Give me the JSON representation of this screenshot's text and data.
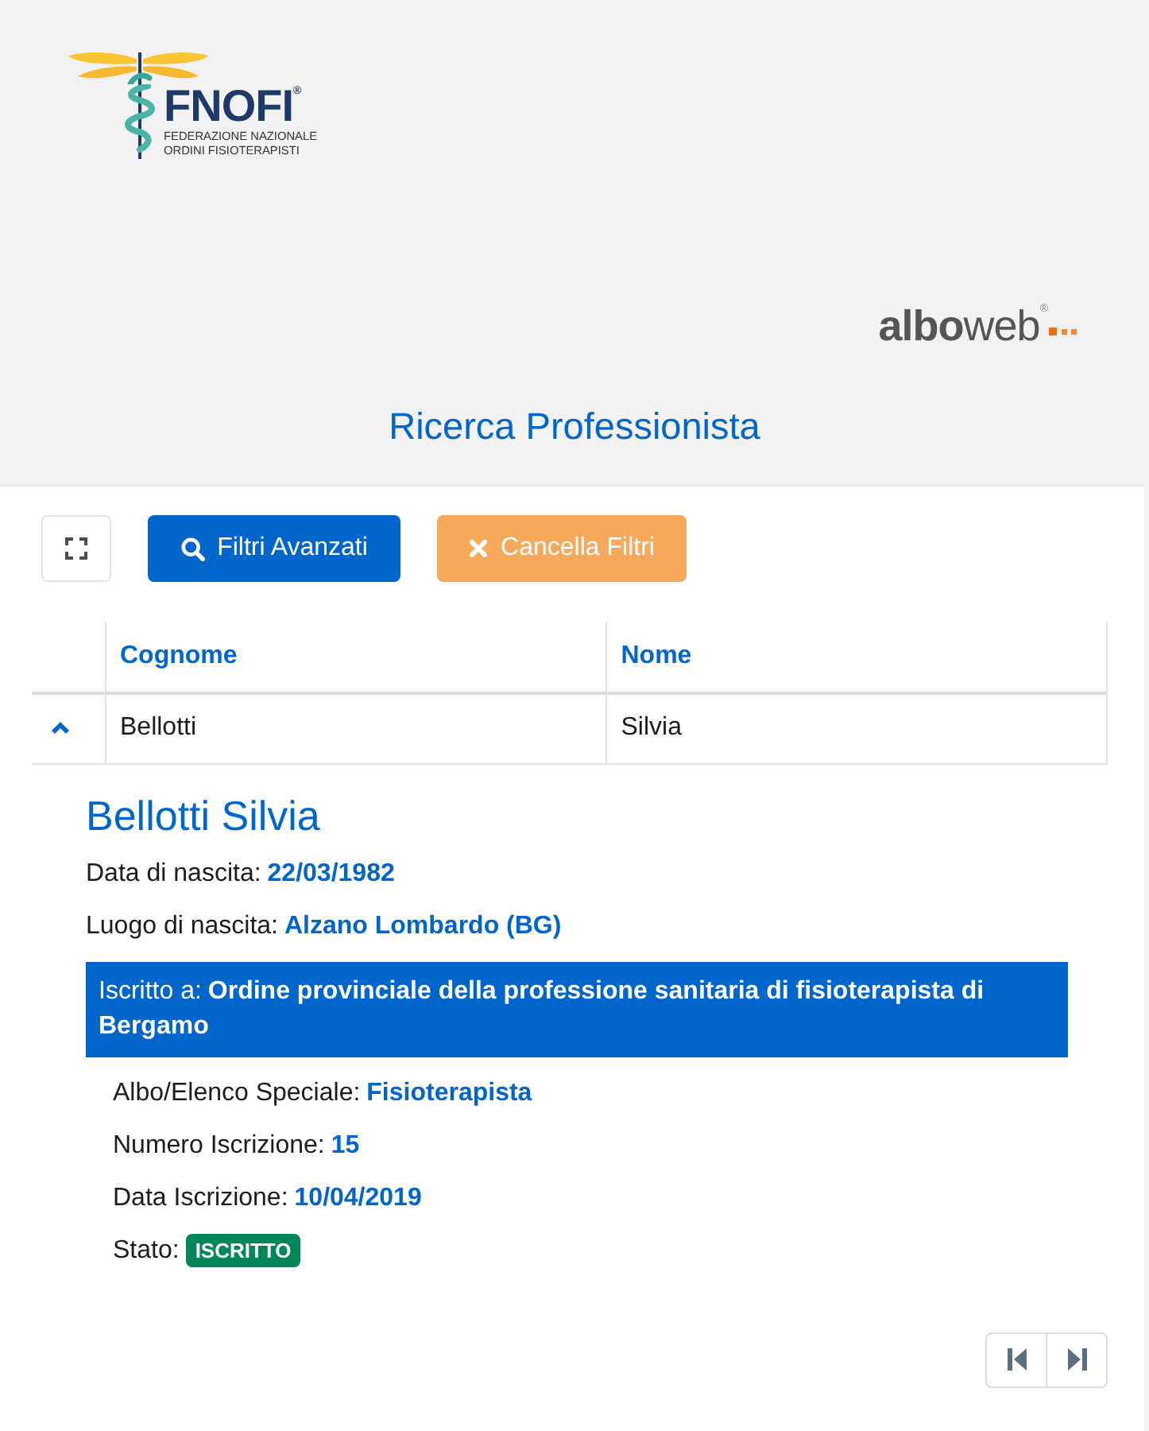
{
  "header": {
    "logo": {
      "wordmark": "FNOFI$^{®}$",
      "tagline": [
        "FEDERAZIONE NAZIONALE",
        "ORDINI FISIOTERAPISTI"
      ]
    },
    "partner_logo": {
      "wordmark": "**albo**web$^{®}$"
    },
    "title": "Ricerca Professionista"
  },
  "toolbar": {
    "buttons": [
      {
        "kind": "fullscreen"
      },
      {
        "kind": "search",
        "label": "Filtri Avanzati"
      },
      {
        "kind": "clear",
        "label": "Cancella Filtri"
      }
    ]
  },
  "table": {
    "columns": [
      "Cognome",
      "Nome"
    ],
    "rows": [
      {
        "expanded": true,
        "cells": [
          "Bellotti",
          "Silvia"
        ],
        "detail": {
          "name": "Bellotti Silvia",
          "fields": [
            {
              "label": "Data di nascita:",
              "value": "22/03/1982"
            },
            {
              "label": "Luogo di nascita:",
              "value": "Alzano Lombardo (BG)"
            }
          ],
          "registration": {
            "label": "Iscritto a:",
            "value": "Ordine provinciale della professione sanitaria di fisioterapista di Bergamo"
          },
          "registration_fields": [
            {
              "kind": "text",
              "label": "Albo/Elenco Speciale:",
              "value": "Fisioterapista"
            },
            {
              "kind": "text",
              "label": "Numero Iscrizione:",
              "value": "15"
            },
            {
              "kind": "text",
              "label": "Data Iscrizione:",
              "value": "10/04/2019"
            },
            {
              "kind": "badge",
              "label": "Stato:",
              "value": "ISCRITTO"
            }
          ]
        }
      }
    ]
  },
  "pagination": [
    {
      "kind": "first"
    },
    {
      "kind": "last"
    }
  ]
}
